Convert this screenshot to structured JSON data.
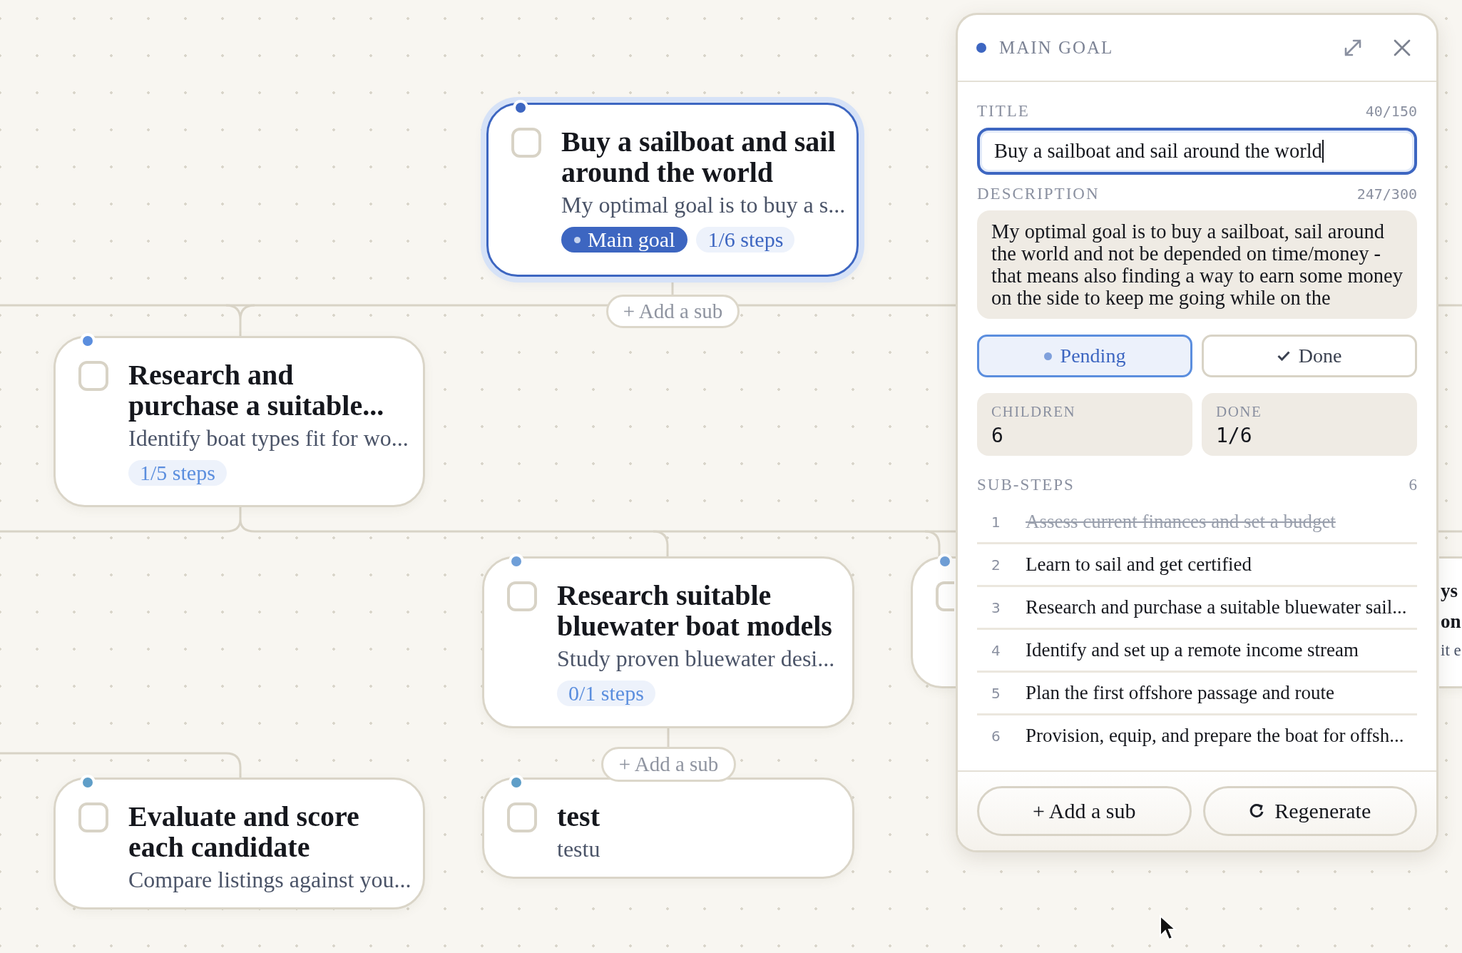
{
  "canvas": {
    "nodes": [
      {
        "title": "Buy a sailboat and sail around the world",
        "description": "My optimal goal is to buy a s...",
        "checked": false,
        "selected": true,
        "color": "#3d66c1",
        "main_badge": "Main goal",
        "steps": "1/6 steps"
      },
      {
        "title": "Research and purchase a suitable...",
        "description": "Identify boat types fit for wo...",
        "checked": false,
        "selected": false,
        "color": "#5b8ede",
        "steps": "1/5 steps"
      },
      {
        "title": "Research suitable bluewater boat models",
        "description": "Study proven bluewater desi...",
        "checked": false,
        "selected": false,
        "color": "#6f9fd8",
        "steps": "0/1 steps"
      },
      {
        "checked": false,
        "selected": false,
        "color": "#6f9fd8"
      },
      {
        "title": "Evaluate and score each candidate",
        "description": "Compare listings against you...",
        "checked": false,
        "selected": false,
        "color": "#5f9ec8"
      },
      {
        "title": "test",
        "description": "testu",
        "checked": false,
        "selected": false,
        "color": "#5f9ec8"
      },
      {
        "title": "ys on",
        "description": "it e",
        "selected": false
      }
    ],
    "add_buttons": [
      {
        "label": "+ Add a sub"
      },
      {
        "label": "+ Add a sub"
      }
    ]
  },
  "panel": {
    "heading": "MAIN GOAL",
    "color": "#3d66c1",
    "title_label": "TITLE",
    "title_count": "40/150",
    "title_value": "Buy a sailboat and sail around the world",
    "description_label": "DESCRIPTION",
    "description_count": "247/300",
    "description_value": "My optimal goal is to buy a sailboat, sail around the world and not be depended on time/money - that means also finding a way to earn some money on the side to keep me going while on the",
    "status_buttons": [
      {
        "label": "Pending",
        "kind": "pending",
        "selected": true
      },
      {
        "label": "Done",
        "kind": "done",
        "selected": false
      }
    ],
    "stats": [
      {
        "label": "CHILDREN",
        "value": "6"
      },
      {
        "label": "DONE",
        "value": "1/6"
      }
    ],
    "substeps_label": "SUB-STEPS",
    "substeps_count": "6",
    "substeps": [
      {
        "number": "1",
        "text": "Assess current finances and set a budget",
        "done": true
      },
      {
        "number": "2",
        "text": "Learn to sail and get certified",
        "done": false
      },
      {
        "number": "3",
        "text": "Research and purchase a suitable bluewater sail...",
        "done": false
      },
      {
        "number": "4",
        "text": "Identify and set up a remote income stream",
        "done": false
      },
      {
        "number": "5",
        "text": "Plan the first offshore passage and route",
        "done": false
      },
      {
        "number": "6",
        "text": "Provision, equip, and prepare the boat for offsh...",
        "done": false
      }
    ],
    "footer_buttons": [
      {
        "label": "+ Add a sub",
        "kind": "add"
      },
      {
        "label": "Regenerate",
        "kind": "regenerate"
      }
    ]
  }
}
